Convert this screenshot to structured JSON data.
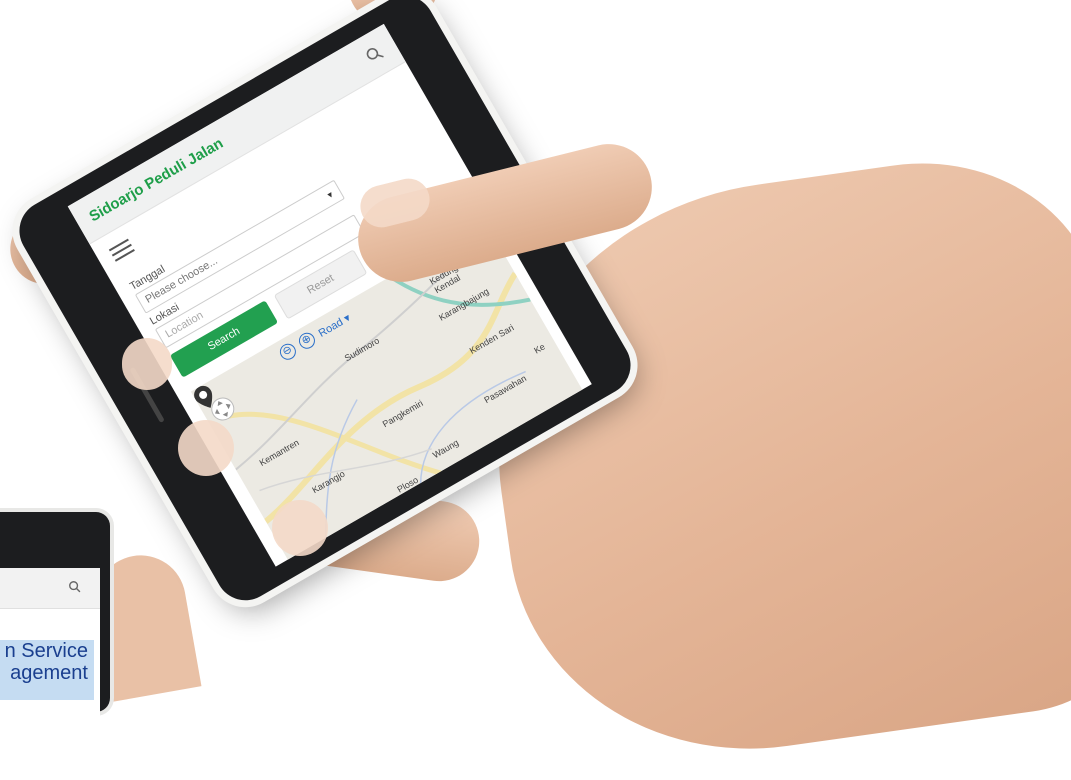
{
  "main_phone": {
    "app_title": "Sidoarjo Peduli Jalan",
    "form": {
      "tanggal_label": "Tanggal",
      "tanggal_placeholder": "Please choose...",
      "lokasi_label": "Lokasi",
      "lokasi_placeholder": "Location",
      "search_button": "Search",
      "reset_button": "Reset"
    },
    "map": {
      "zoom_out": "⊖",
      "zoom_in": "⊕",
      "map_type": "Road ▾",
      "places": [
        "Kedung",
        "Kendal",
        "Sudimoro",
        "Karangbajung",
        "Kemantren",
        "Kenden Sari",
        "Pangkemiri",
        "Karangjo",
        "Pasawahan",
        "Waung",
        "Ploso",
        "Ke"
      ]
    }
  },
  "second_phone": {
    "banner_line1": "n Service",
    "banner_line2": "agement"
  },
  "icons": {
    "search": "search-icon",
    "menu": "hamburger-menu-icon",
    "marker": "map-marker-icon",
    "nav": "map-pan-icon"
  },
  "colors": {
    "brand_green": "#1e9e49",
    "button_green": "#22a050",
    "link_blue": "#2a6fc9",
    "banner_blue": "#c5dcf2"
  }
}
